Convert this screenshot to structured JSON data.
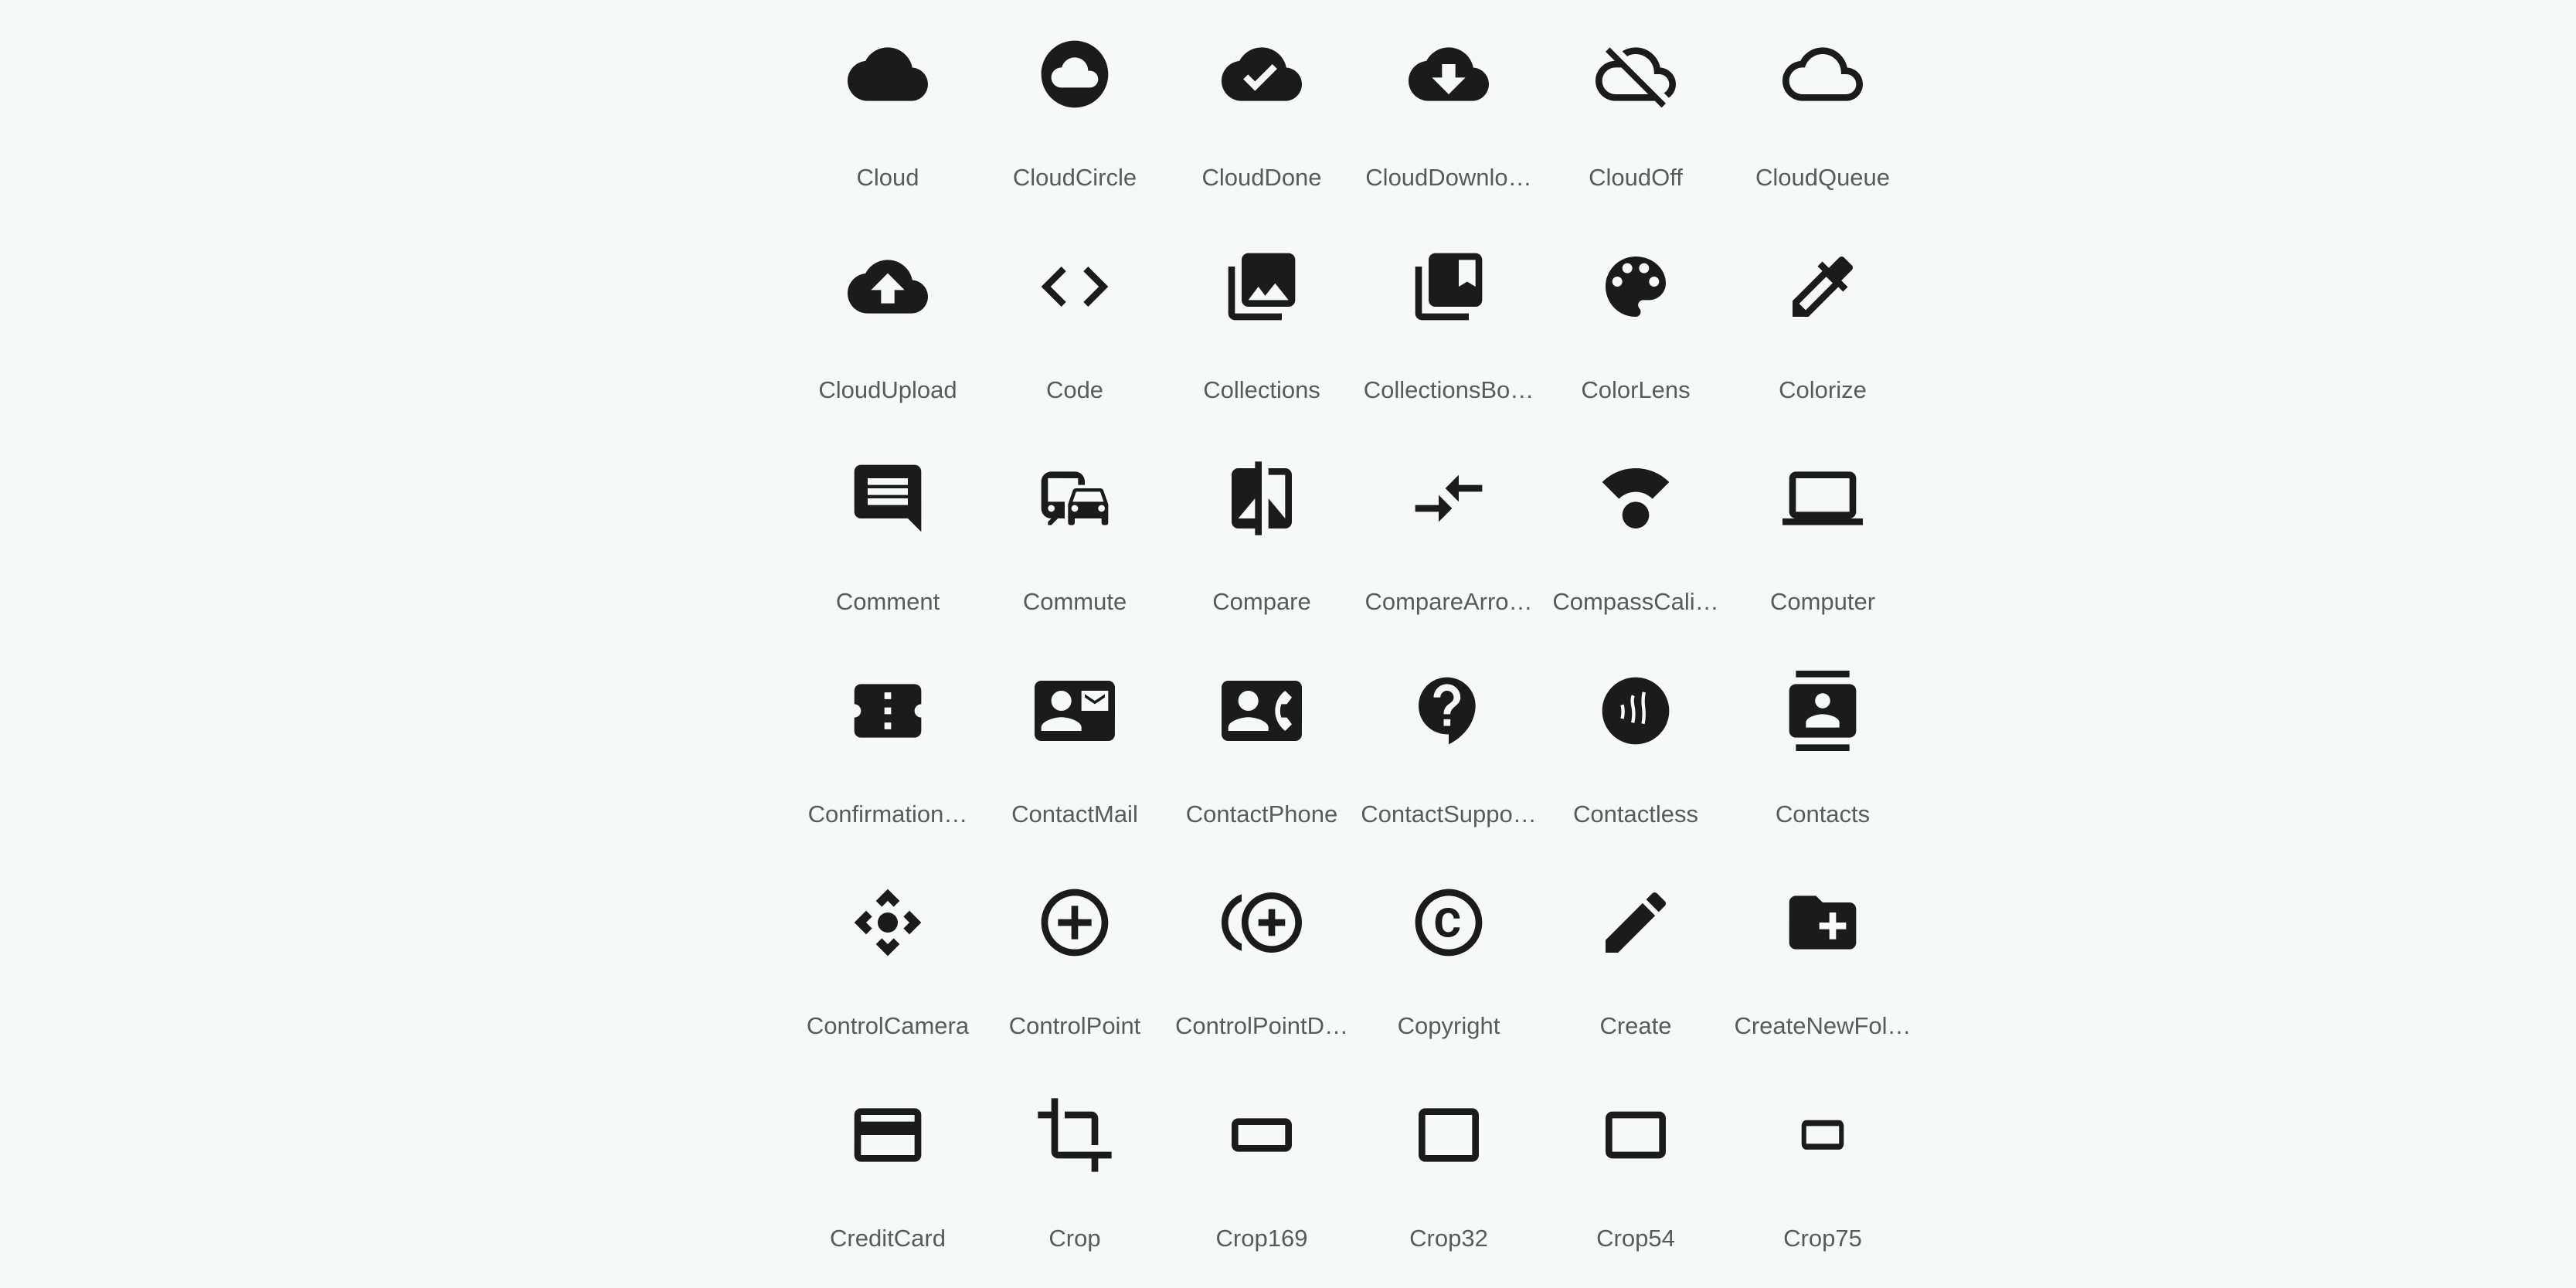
{
  "icons": [
    {
      "name": "cloud-icon",
      "label": "Cloud"
    },
    {
      "name": "cloud-circle-icon",
      "label": "CloudCircle"
    },
    {
      "name": "cloud-done-icon",
      "label": "CloudDone"
    },
    {
      "name": "cloud-download-icon",
      "label": "CloudDownlo…"
    },
    {
      "name": "cloud-off-icon",
      "label": "CloudOff"
    },
    {
      "name": "cloud-queue-icon",
      "label": "CloudQueue"
    },
    {
      "name": "cloud-upload-icon",
      "label": "CloudUpload"
    },
    {
      "name": "code-icon",
      "label": "Code"
    },
    {
      "name": "collections-icon",
      "label": "Collections"
    },
    {
      "name": "collections-bookmark-icon",
      "label": "CollectionsBo…"
    },
    {
      "name": "color-lens-icon",
      "label": "ColorLens"
    },
    {
      "name": "colorize-icon",
      "label": "Colorize"
    },
    {
      "name": "comment-icon",
      "label": "Comment"
    },
    {
      "name": "commute-icon",
      "label": "Commute"
    },
    {
      "name": "compare-icon",
      "label": "Compare"
    },
    {
      "name": "compare-arrows-icon",
      "label": "CompareArro…"
    },
    {
      "name": "compass-calibration-icon",
      "label": "CompassCali…"
    },
    {
      "name": "computer-icon",
      "label": "Computer"
    },
    {
      "name": "confirmation-number-icon",
      "label": "Confirmation…"
    },
    {
      "name": "contact-mail-icon",
      "label": "ContactMail"
    },
    {
      "name": "contact-phone-icon",
      "label": "ContactPhone"
    },
    {
      "name": "contact-support-icon",
      "label": "ContactSuppo…"
    },
    {
      "name": "contactless-icon",
      "label": "Contactless"
    },
    {
      "name": "contacts-icon",
      "label": "Contacts"
    },
    {
      "name": "control-camera-icon",
      "label": "ControlCamera"
    },
    {
      "name": "control-point-icon",
      "label": "ControlPoint"
    },
    {
      "name": "control-point-duplicate-icon",
      "label": "ControlPointD…"
    },
    {
      "name": "copyright-icon",
      "label": "Copyright"
    },
    {
      "name": "create-icon",
      "label": "Create"
    },
    {
      "name": "create-new-folder-icon",
      "label": "CreateNewFol…"
    },
    {
      "name": "credit-card-icon",
      "label": "CreditCard"
    },
    {
      "name": "crop-icon",
      "label": "Crop"
    },
    {
      "name": "crop-169-icon",
      "label": "Crop169"
    },
    {
      "name": "crop-32-icon",
      "label": "Crop32"
    },
    {
      "name": "crop-54-icon",
      "label": "Crop54"
    },
    {
      "name": "crop-75-icon",
      "label": "Crop75"
    }
  ],
  "colors": {
    "background": "#f7f9f8",
    "icon": "#1b1b1b",
    "label": "#5a5a5a"
  }
}
